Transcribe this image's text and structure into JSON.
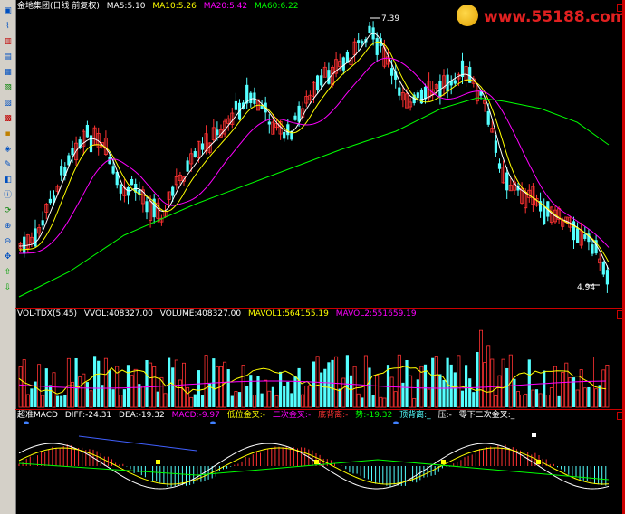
{
  "toolbar": {
    "icons": [
      "chart-icon",
      "line-chart-icon",
      "bar-chart-icon",
      "candle-icon",
      "table-icon",
      "grid-icon",
      "report-icon",
      "calendar-icon",
      "image-icon",
      "group-icon",
      "tools-icon",
      "layout-icon",
      "info-icon",
      "refresh-icon",
      "plus-icon",
      "minus-icon",
      "zoom-icon",
      "arrow-up-icon",
      "arrow-down-icon"
    ]
  },
  "main_legend": {
    "title": "金地集团(日线 前复权)",
    "ma5": "MA5:5.10",
    "ma10": "MA10:5.26",
    "ma20": "MA20:5.42",
    "ma60": "MA60:6.22"
  },
  "price_labels": {
    "high": "7.39",
    "low": "4.94"
  },
  "volume_legend": {
    "title": "VOL-TDX(5,45)",
    "vvol": "VVOL:408327.00",
    "volume": "VOLUME:408327.00",
    "mavol1": "MAVOL1:564155.19",
    "mavol2": "MAVOL2:551659.19"
  },
  "macd_legend": {
    "title": "超准MACD",
    "diff": "DIFF:-24.31",
    "dea": "DEA:-19.32",
    "macd": "MACD:-9.97",
    "s1": "低位金叉:-",
    "s2": "二次金叉:-",
    "s3": "底背离:-",
    "s4": "势:-19.32",
    "s5": "顶背离:_",
    "s6": "压:-",
    "s7": "零下二次金叉:_"
  },
  "watermark": "www.55188.com",
  "colors": {
    "up": "#ff3232",
    "down": "#54ffff",
    "ma5": "#ffffff",
    "ma10": "#ffff00",
    "ma20": "#ff00ff",
    "ma60": "#00ff00",
    "sep": "#cc0000",
    "blueLine": "#4060ff"
  },
  "chart_data": {
    "type": "candlestick",
    "title": "金地集团(日线 前复权)",
    "series": [
      {
        "name": "MA5",
        "last": 5.1
      },
      {
        "name": "MA10",
        "last": 5.26
      },
      {
        "name": "MA20",
        "last": 5.42
      },
      {
        "name": "MA60",
        "last": 6.22
      }
    ],
    "price_high": 7.39,
    "price_low": 4.94
  }
}
